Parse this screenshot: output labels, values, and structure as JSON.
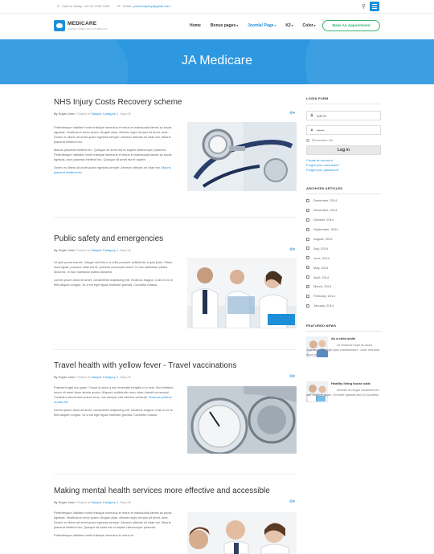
{
  "topbar": {
    "call_text": "Call Us Today: +44 20 7539 7900",
    "email_label": "Email:",
    "email_value": "yourcompany@gmail.com"
  },
  "logo": {
    "name": "MEDICARE",
    "tagline": "JOOMLA TEMPLATE FOR MEDICAL"
  },
  "nav": {
    "items": [
      {
        "label": "Home"
      },
      {
        "label": "Bonus pages",
        "caret": "▾"
      },
      {
        "label": "Joomla! Page",
        "caret": "▾"
      },
      {
        "label": "K2",
        "caret": "▾"
      },
      {
        "label": "Color",
        "caret": "▾"
      }
    ],
    "appointment_label": "Make An Appointment"
  },
  "hero": {
    "title": "JA Medicare"
  },
  "articles": [
    {
      "title": "NHS Injury Costs Recovery scheme",
      "by": "By Super User",
      "posted_in": "Posted in",
      "category": "Sample Category 1",
      "date": "May 06",
      "paragraphs": [
        "Pellentesque habitant morbi tristique senectus et netus et malesuada fames ac turpis egestas. Vestibulum tortor quam, feugiat vitae, ultricies eget, tempor sit amet, ante. Donec eu libero sit amet quam egestas semper. Aenean ultricies mi vitae est. Mauris placerat eleifend leo.",
        "Mauris placerat eleifend leo. Quisque sit amet est et sapien ullamcorper pharetra. Pellentesque habitant morbi tristique senectus et netus et malesuada fames ac turpis egestas, aura placerat eleifend leo. Quisque sit amet est et sapien",
        "Donec eu libero sit amet quam egestas semper. Aenean ultricies mi vitae est."
      ],
      "link": "Mauris placerat eleifend leo."
    },
    {
      "title": "Public safety and emergencies",
      "by": "By Super User",
      "posted_in": "Posted in",
      "category": "Sample Category 1",
      "date": "May 06",
      "paragraphs": [
        "Ut quis purus mauris. Integer sed libero a nulla posuere sollicitudin a quis justo. Etiam risus ligula, posuere vitae est id, pulvinar commodo dolor? In hac habitasse platea dictumst. In hac habitasse platea dictumst",
        "Lorem ipsum dolor sit amet, consectetur adipiscing elit. Vivamus magna. Cras in mi at felis aliquet congue. Ut a est eget ligula molestie gravida. Curabitur massa."
      ]
    },
    {
      "title": "Travel health with yellow fever - Travel vaccinations",
      "by": "By Super User",
      "posted_in": "Posted in",
      "category": "Sample Category 1",
      "date": "May 06",
      "paragraphs": [
        "Praesent eget dui quam. Fusce id dolor a est venenatis fringilla id in erat. Sed eleifend lorem sit amet diam lacinia auctor. Aliquam sollicitudin nunc vitae blandit commodo! Curabitur elementum ipsum eros, non semper nisl ultricies vehicula.",
        "Lorem ipsum dolor sit amet, consectetur adipiscing elit. Vivamus magna. Cras in mi at felis aliquet congue. Ut a est eget ligula molestie gravida. Curabitur massa."
      ],
      "link": "Vivamus pretium ornare est."
    },
    {
      "title": "Making mental health services more effective and accessible",
      "by": "By Super User",
      "posted_in": "Posted in",
      "category": "Sample Category 1",
      "date": "May 06",
      "paragraphs": [
        "Pellentesque habitant morbi tristique senectus et netus et malesuada fames ac turpis egestas. Vestibulum tortor quam, feugiat vitae, ultricies eget, tempor sit amet, ante. Donec eu libero sit amet quam egestas semper. Aenean ultricies mi vitae est. Mauris placerat eleifend leo. Quisque sit amet est et sapien ullamcorper pharetra.",
        "Pellentesque habitant morbi tristique senectus et netus et"
      ]
    }
  ],
  "sidebar": {
    "login": {
      "title": "LOGIN FORM",
      "username_value": "admin",
      "password_value": "••••••",
      "remember_label": "Remember Me",
      "button_label": "Log in",
      "links": [
        "Create an account",
        "Forgot your username?",
        "Forgot your password?"
      ]
    },
    "archive": {
      "title": "ARCHIVED ARTICLES",
      "months": [
        "December, 2014",
        "November, 2014",
        "October, 2014",
        "September, 2014",
        "August, 2014",
        "July, 2014",
        "June, 2014",
        "May, 2014",
        "April, 2014",
        "March, 2014",
        "February, 2014",
        "January, 2014"
      ]
    },
    "featured": {
      "title": "FEATURED NEWS",
      "items": [
        {
          "title": "As a child smile",
          "text": "Ut Vivamus turpe du lacus Aliquam quam eget quis condimentum. Justo sed ante lacus at ..."
        },
        {
          "title": "Healthy living house calls",
          "text": "Aenean et neque condimentum wisi dapibus quam. Sit amet egestas.Nec id Curabitur ..."
        }
      ]
    }
  },
  "colors": {
    "accent": "#1d8fd8",
    "hero_bg": "#2d97e0",
    "appointment_green": "#3cb371"
  }
}
